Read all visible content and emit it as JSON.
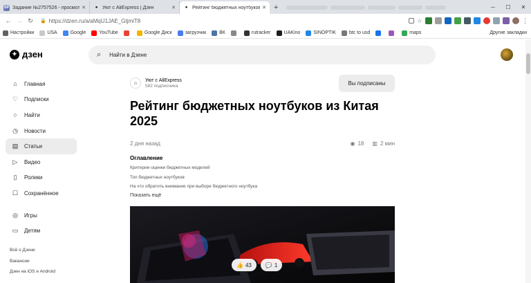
{
  "browser": {
    "tabs": [
      {
        "favicon": "SP",
        "favicon_color": "#6b7ab8",
        "label": "Задание №2757526 - просмотр з",
        "active": false
      },
      {
        "favicon": "●",
        "favicon_color": "#111111",
        "label": "Уют с AliExpress | Дзен",
        "active": false
      },
      {
        "favicon": "●",
        "favicon_color": "#111111",
        "label": "Рейтинг бюджетных ноутбуков",
        "active": true
      }
    ],
    "new_tab": "+",
    "url": "https://dzen.ru/a/aMqU1JAE_GtjmiT8",
    "bookmarks": [
      {
        "label": "Настройки",
        "color": "#5f6368"
      },
      {
        "label": "USA",
        "color": "#c9c9c9"
      },
      {
        "label": "Google",
        "color": "#4285f4"
      },
      {
        "label": "YouTube",
        "color": "#ff0000"
      },
      {
        "label": "",
        "color": "#ea4335"
      },
      {
        "label": "Google Диск",
        "color": "#f4b400"
      },
      {
        "label": "загрузчик",
        "color": "#4b7bec"
      },
      {
        "label": "ВК",
        "color": "#4c75a3"
      },
      {
        "label": "",
        "color": "#888888"
      },
      {
        "label": "rutracker",
        "color": "#333333"
      },
      {
        "label": "UAKino",
        "color": "#1d1d1d"
      },
      {
        "label": "SINOPTIK",
        "color": "#1e88e5"
      },
      {
        "label": "btc to usd",
        "color": "#777777"
      },
      {
        "label": "",
        "color": "#1a73e8"
      },
      {
        "label": "",
        "color": "#9b59b6"
      },
      {
        "label": "maps",
        "color": "#34a853"
      }
    ],
    "bookmarks_other": "Другие закладки"
  },
  "header": {
    "logo": "дзен",
    "search_placeholder": "Найти в Дзене"
  },
  "sidebar": {
    "items": [
      {
        "icon": "home-icon",
        "glyph": "⌂",
        "label": "Главная",
        "active": false
      },
      {
        "icon": "subscriptions-icon",
        "glyph": "♡",
        "label": "Подписки",
        "active": false
      },
      {
        "icon": "search-icon",
        "glyph": "○",
        "label": "Найти",
        "active": false
      },
      {
        "icon": "news-icon",
        "glyph": "◷",
        "label": "Новости",
        "active": false
      },
      {
        "icon": "articles-icon",
        "glyph": "▤",
        "label": "Статьи",
        "active": true
      },
      {
        "icon": "video-icon",
        "glyph": "▷",
        "label": "Видео",
        "active": false
      },
      {
        "icon": "shorts-icon",
        "glyph": "▯",
        "label": "Ролики",
        "active": false
      },
      {
        "icon": "saved-icon",
        "glyph": "☐",
        "label": "Сохранённое",
        "active": false
      }
    ],
    "items2": [
      {
        "icon": "games-icon",
        "glyph": "◎",
        "label": "Игры"
      },
      {
        "icon": "kids-icon",
        "glyph": "▭",
        "label": "Детям"
      }
    ],
    "footer": [
      "Всё о Дзене",
      "Вакансии",
      "Дзен на iOS и Android"
    ]
  },
  "article": {
    "channel_name": "Уют с AliExpress",
    "channel_subs": "582 подписчика",
    "subscribe_label": "Вы подписаны",
    "title": "Рейтинг бюджетных ноутбуков из Китая 2025",
    "date": "2 дня назад",
    "views": "18",
    "read_time": "2 мин",
    "toc_title": "Оглавление",
    "toc": [
      "Критерии оценки бюджетных моделей",
      "Топ бюджетных ноутбуков",
      "На что обратить внимание при выборе бюджетного ноутбука"
    ],
    "show_more": "Показать ещё",
    "likes": "43",
    "comments": "1"
  }
}
